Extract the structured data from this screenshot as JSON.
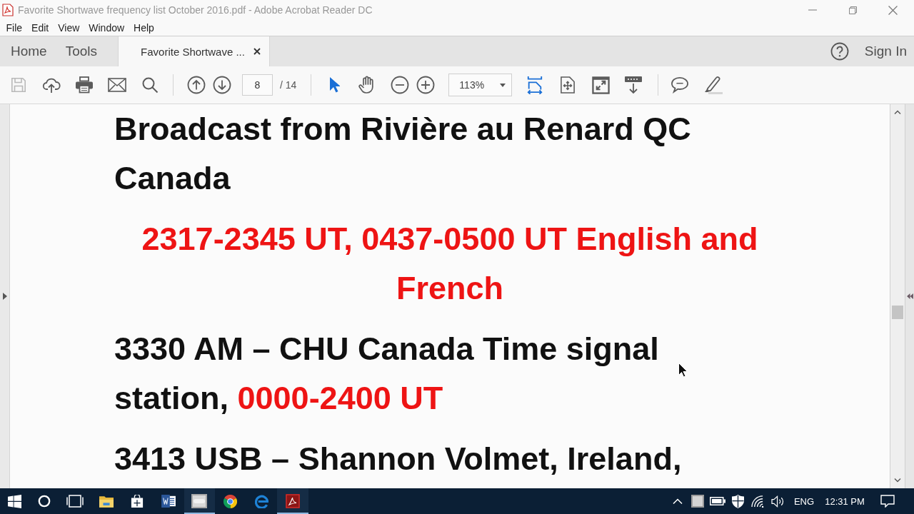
{
  "window": {
    "title": "Favorite Shortwave frequency list October 2016.pdf - Adobe Acrobat Reader DC"
  },
  "menu": [
    "File",
    "Edit",
    "View",
    "Window",
    "Help"
  ],
  "tabs": [
    {
      "label": "Home",
      "selected": false,
      "closable": false
    },
    {
      "label": "Tools",
      "selected": false,
      "closable": false
    },
    {
      "label": "Favorite Shortwave ...",
      "selected": true,
      "closable": true
    }
  ],
  "account": {
    "label": "Sign In"
  },
  "toolbar": {
    "save": {
      "disabled": true
    },
    "page": {
      "value": "8",
      "total": "/ 14"
    },
    "pointer_tools": [
      {
        "selected": true
      },
      {
        "selected": false
      }
    ],
    "zoom": {
      "value": "113%"
    },
    "fit_width": {
      "on": true
    }
  },
  "document": {
    "paragraphs": [
      {
        "kind": "station",
        "lines": [
          "Broadcast from Rivière au Renard QC",
          "Canada"
        ]
      },
      {
        "kind": "schedule",
        "lines": [
          "2317-2345 UT, 0437-0500 UT English and",
          "French"
        ]
      },
      {
        "kind": "station",
        "lines": [
          "3330 AM – CHU Canada Time signal",
          "station,"
        ],
        "schedule": "0000-2400 UT"
      },
      {
        "kind": "station",
        "lines": [
          "3413 USB – Shannon Volmet, Ireland,"
        ]
      }
    ]
  },
  "taskbar": {
    "apps": [
      {
        "running": false
      },
      {
        "running": false
      },
      {
        "running": false
      },
      {
        "running": true
      },
      {
        "running": false
      },
      {
        "running": false
      },
      {
        "running": true
      }
    ],
    "tray": {
      "language": "ENG",
      "clock": "12:31 PM"
    }
  }
}
